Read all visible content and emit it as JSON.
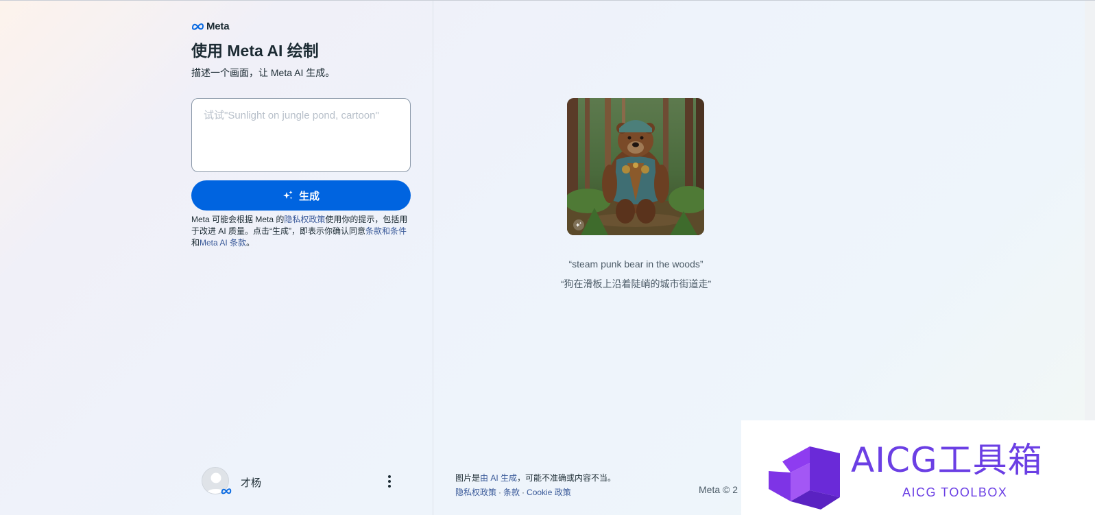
{
  "brand": {
    "name": "Meta",
    "icon": "meta-logo-icon"
  },
  "header": {
    "title": "使用 Meta AI 绘制",
    "subtitle": "描述一个画面，让 Meta AI 生成。"
  },
  "prompt": {
    "value": "",
    "placeholder": "试试\"Sunlight on jungle pond, cartoon\""
  },
  "generate_button": {
    "label": "生成",
    "icon": "sparkle-icon"
  },
  "disclaimer": {
    "text_1": "Meta 可能会根据 Meta 的",
    "privacy_link": "隐私权政策",
    "text_2": "使用你的提示，包括用于改进 AI 质量。点击“生成”，即表示你确认同意",
    "terms_link": "条款和条件",
    "text_3": "和",
    "meta_ai_terms_link": "Meta AI 条款",
    "text_4": "。"
  },
  "user": {
    "name": "才杨",
    "avatar_icon": "default-avatar-icon",
    "badge_icon": "meta-badge-icon",
    "menu_icon": "more-vertical-icon"
  },
  "preview": {
    "image_alt": "steam punk bear in the woods",
    "caption_1": "“steam punk bear in the woods”",
    "caption_2": "“狗在滑板上沿着陡峭的城市街道走”",
    "badge_icon": "ai-generated-icon"
  },
  "footer": {
    "note_1": "图片是",
    "note_link": "由 AI 生成",
    "note_2": "，可能不准确或内容不当。",
    "links": [
      "隐私权政策",
      "条款",
      "Cookie 政策"
    ],
    "separator": "·",
    "copyright": "Meta © 2"
  },
  "watermark": {
    "title": "AICG工具箱",
    "subtitle": "AICG TOOLBOX"
  },
  "colors": {
    "accent": "#0064e0",
    "link": "#385898",
    "watermark": "#6b3fe4"
  }
}
